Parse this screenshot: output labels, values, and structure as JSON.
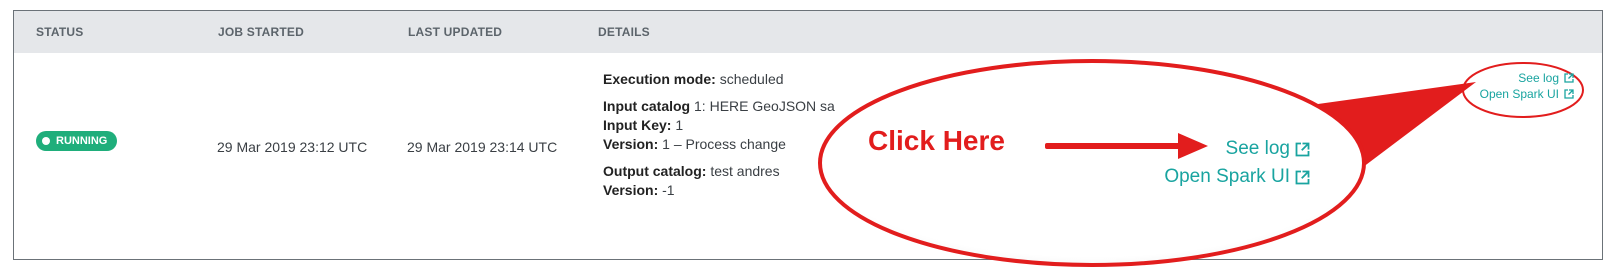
{
  "table": {
    "headers": {
      "status": "STATUS",
      "job_started": "JOB STARTED",
      "last_updated": "LAST UPDATED",
      "details": "DETAILS"
    },
    "row": {
      "status_badge": "RUNNING",
      "job_started": "29 Mar 2019 23:12 UTC",
      "last_updated": "29 Mar 2019 23:14 UTC",
      "details": {
        "execution_mode_label": "Execution mode:",
        "execution_mode_value": "scheduled",
        "input_catalog_label": "Input catalog",
        "input_catalog_value": "1: HERE GeoJSON sa",
        "input_key_label": "Input Key:",
        "input_key_value": "1",
        "input_version_label": "Version:",
        "input_version_value": "1 – Process change",
        "output_catalog_label": "Output catalog:",
        "output_catalog_value": "test andres",
        "output_version_label": "Version:",
        "output_version_value": "-1"
      },
      "links": {
        "see_log": "See log",
        "open_spark_ui": "Open Spark UI"
      }
    }
  },
  "callout": {
    "click_here": "Click Here",
    "see_log": "See log",
    "open_spark_ui": "Open Spark UI"
  },
  "colors": {
    "header_bg": "#e5e7ea",
    "badge_green": "#1fae7b",
    "link_teal": "#19a4a0",
    "annotation_red": "#e21d1d"
  },
  "icons": {
    "external_link": "external-link-icon",
    "arrow": "arrow-right-icon"
  }
}
